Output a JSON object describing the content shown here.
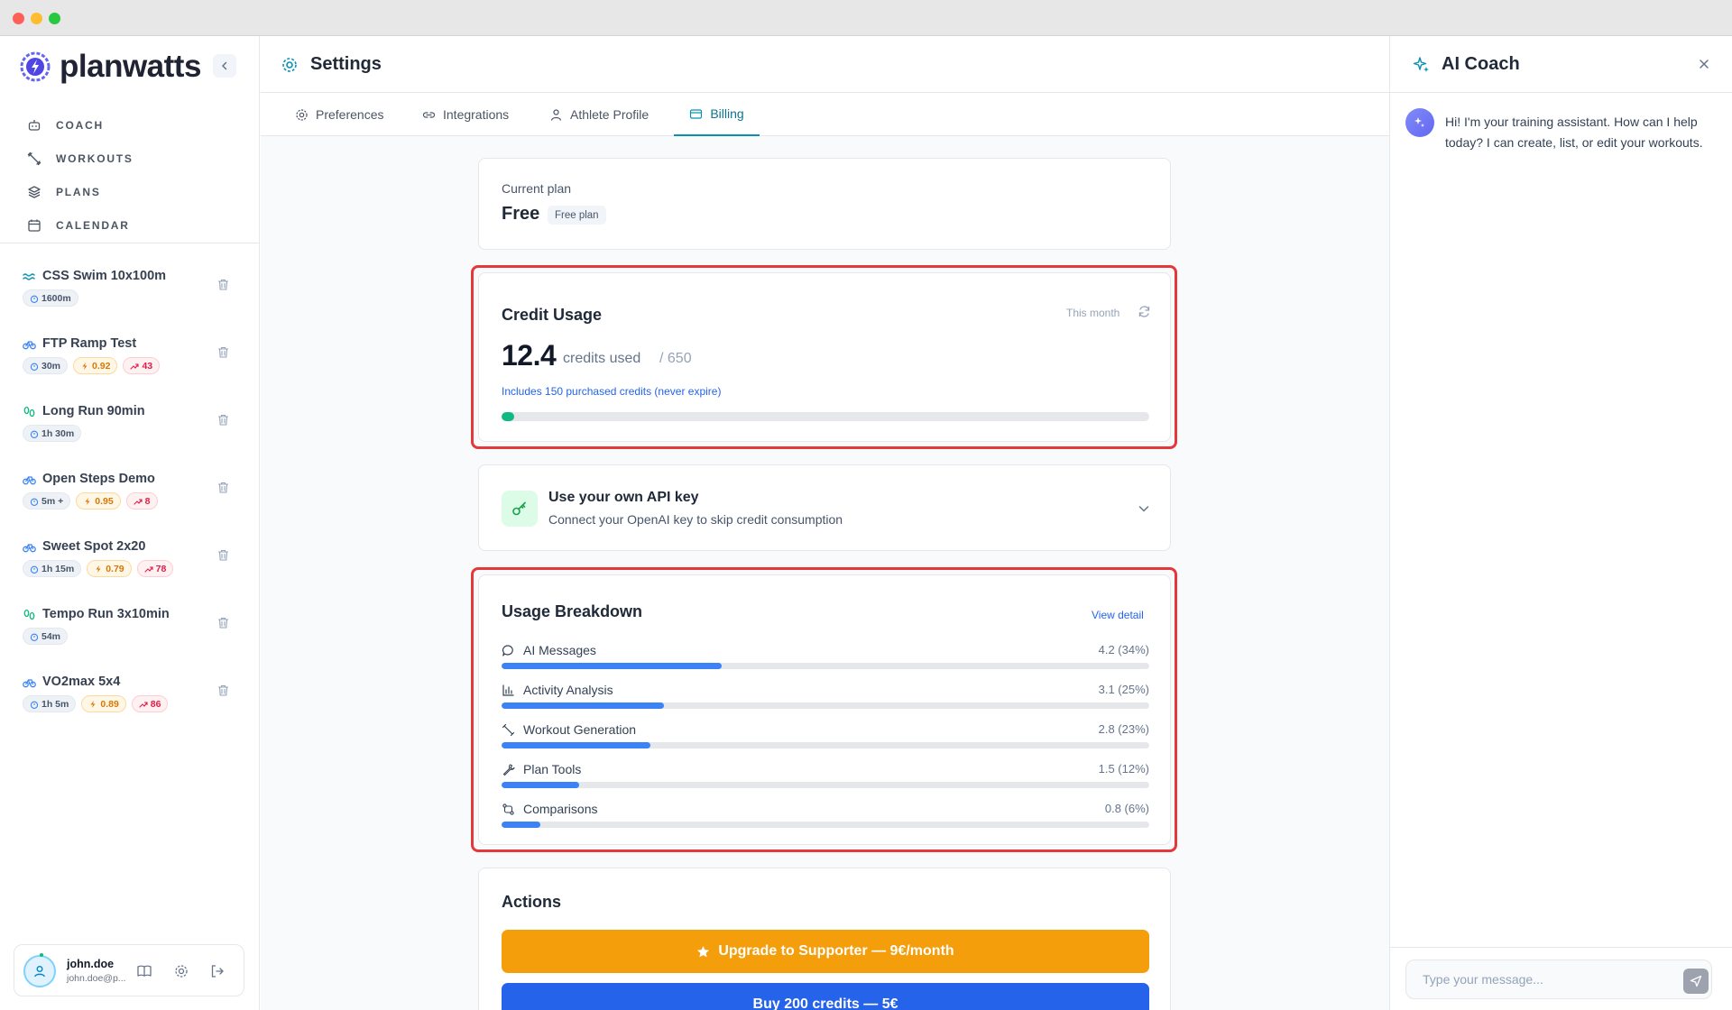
{
  "app": {
    "brand": "planwatts"
  },
  "nav": [
    {
      "label": "COACH",
      "icon": "robot-icon"
    },
    {
      "label": "WORKOUTS",
      "icon": "dumbbell-icon"
    },
    {
      "label": "PLANS",
      "icon": "layers-icon"
    },
    {
      "label": "CALENDAR",
      "icon": "calendar-icon"
    }
  ],
  "workouts": [
    {
      "name": "CSS Swim 10x100m",
      "sport": "swim",
      "duration": "1600m",
      "if": "",
      "tss": ""
    },
    {
      "name": "FTP Ramp Test",
      "sport": "bike",
      "duration": "30m",
      "if": "0.92",
      "tss": "43"
    },
    {
      "name": "Long Run 90min",
      "sport": "run",
      "duration": "1h 30m",
      "if": "",
      "tss": ""
    },
    {
      "name": "Open Steps Demo",
      "sport": "bike",
      "duration": "5m +",
      "if": "0.95",
      "tss": "8"
    },
    {
      "name": "Sweet Spot 2x20",
      "sport": "bike",
      "duration": "1h 15m",
      "if": "0.79",
      "tss": "78"
    },
    {
      "name": "Tempo Run 3x10min",
      "sport": "run",
      "duration": "54m",
      "if": "",
      "tss": ""
    },
    {
      "name": "VO2max 5x4",
      "sport": "bike",
      "duration": "1h 5m",
      "if": "0.89",
      "tss": "86"
    }
  ],
  "user": {
    "name": "john.doe",
    "email": "john.doe@p..."
  },
  "header": {
    "title": "Settings"
  },
  "tabs": [
    {
      "label": "Preferences",
      "active": false
    },
    {
      "label": "Integrations",
      "active": false
    },
    {
      "label": "Athlete Profile",
      "active": false
    },
    {
      "label": "Billing",
      "active": true
    }
  ],
  "billing": {
    "current_plan": {
      "label": "Current plan",
      "name": "Free",
      "badge": "Free plan"
    },
    "credit_usage": {
      "title": "Credit Usage",
      "period": "This month",
      "used": "12.4",
      "used_label": "credits used",
      "limit": "/ 650",
      "used_fraction": 0.019,
      "purchased_note": "Includes 150 purchased credits (never expire)"
    },
    "api_key": {
      "title": "Use your own API key",
      "subtitle": "Connect your OpenAI key to skip credit consumption"
    },
    "breakdown": {
      "title": "Usage Breakdown",
      "link": "View detail",
      "items": [
        {
          "label": "AI Messages",
          "value": "4.2 (34%)",
          "percent": 34,
          "icon": "message-icon"
        },
        {
          "label": "Activity Analysis",
          "value": "3.1 (25%)",
          "percent": 25,
          "icon": "bar-chart-icon"
        },
        {
          "label": "Workout Generation",
          "value": "2.8 (23%)",
          "percent": 23,
          "icon": "dumbbell-icon"
        },
        {
          "label": "Plan Tools",
          "value": "1.5 (12%)",
          "percent": 12,
          "icon": "wrench-icon"
        },
        {
          "label": "Comparisons",
          "value": "0.8 (6%)",
          "percent": 6,
          "icon": "compare-icon"
        }
      ]
    },
    "actions": {
      "title": "Actions",
      "upgrade_label": "Upgrade to Supporter — 9€/month",
      "buy_label": "Buy 200 credits — 5€"
    }
  },
  "ai_coach": {
    "title": "AI Coach",
    "greeting": "Hi! I'm your training assistant. How can I help today? I can create, list, or edit your workouts.",
    "input_placeholder": "Type your message..."
  },
  "colors": {
    "accent": "#0891b2",
    "primary_blue": "#2563eb",
    "upgrade_orange": "#f59e0b",
    "usage_green": "#10b981",
    "highlight_red": "#e5383b"
  }
}
